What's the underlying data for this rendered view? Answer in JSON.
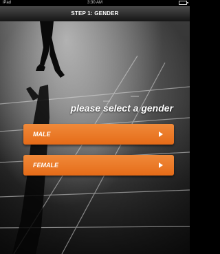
{
  "status_bar": {
    "carrier": "iPad",
    "time": "3:30 AM"
  },
  "nav": {
    "title": "STEP 1: GENDER"
  },
  "prompt": "please select a gender",
  "buttons": [
    {
      "label": "MALE"
    },
    {
      "label": "FEMALE"
    }
  ],
  "colors": {
    "button": "#e96f1f",
    "nav": "#2a2a2a",
    "text": "#ffffff"
  },
  "icons": {
    "button_arrow": "play-triangle-icon"
  }
}
